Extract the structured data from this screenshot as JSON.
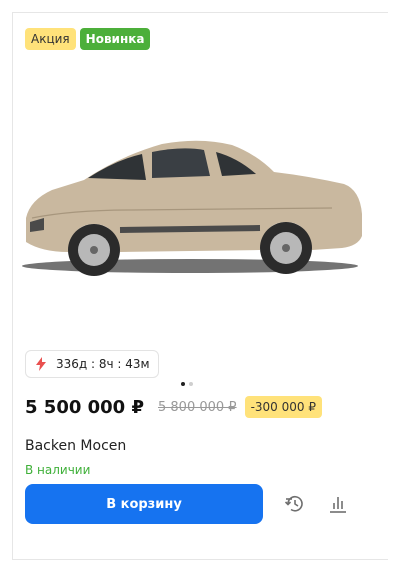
{
  "badges": {
    "sale": "Акция",
    "new": "Новинка"
  },
  "timer": {
    "text": "336д : 8ч : 43м",
    "icon": "lightning-icon"
  },
  "carousel": {
    "slides": 2,
    "active": 1
  },
  "price": {
    "current": "5 500 000 ₽",
    "old": "5 800 000 ₽",
    "discount": "-300 000 ₽"
  },
  "product": {
    "name": "Backen Mocen",
    "availability": "В наличии"
  },
  "actions": {
    "cart_label": "В корзину",
    "history_icon": "history-icon",
    "compare_icon": "compare-chart-icon"
  },
  "colors": {
    "accent": "#1673f0",
    "in_stock": "#3fb039",
    "sale_badge": "#ffe27a",
    "new_badge": "#4caf3a",
    "timer_icon": "#e9504f"
  }
}
